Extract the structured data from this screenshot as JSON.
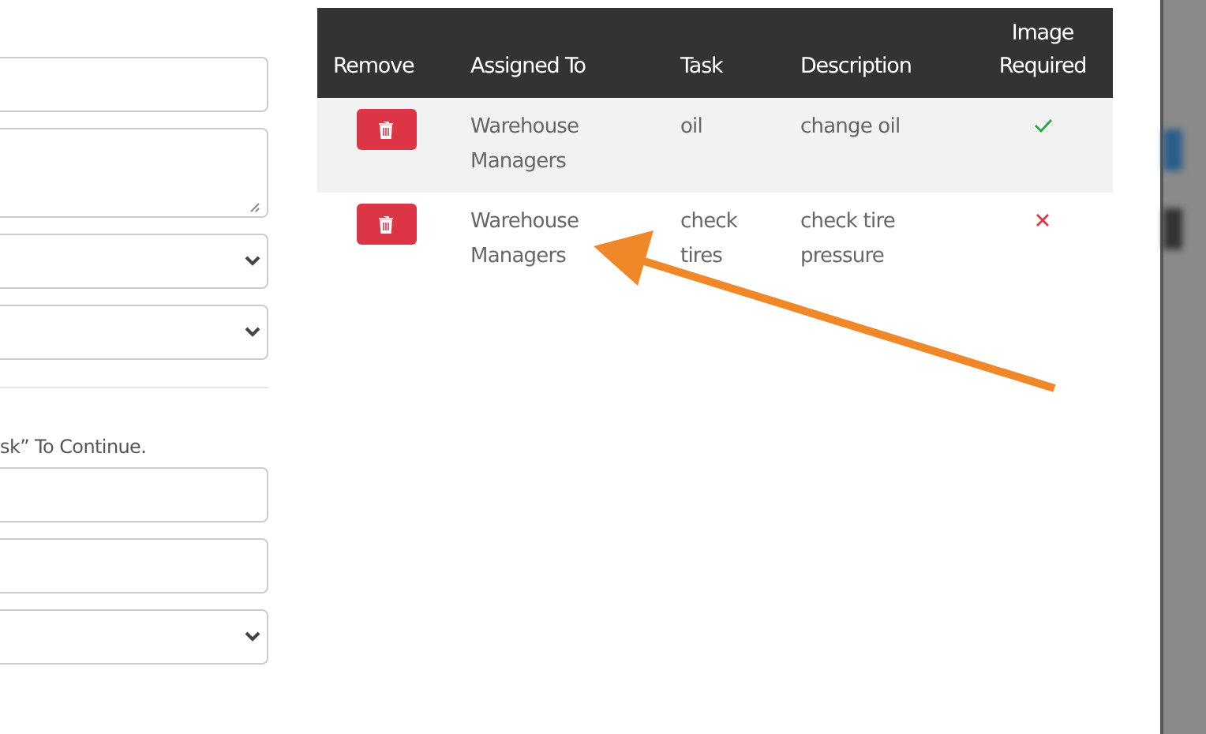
{
  "form": {
    "fields": [
      {
        "kind": "input"
      },
      {
        "kind": "textarea"
      },
      {
        "kind": "select"
      },
      {
        "kind": "select"
      },
      {
        "kind": "divider"
      },
      {
        "kind": "note",
        "text": "sk” To Continue."
      },
      {
        "kind": "input"
      },
      {
        "kind": "input"
      },
      {
        "kind": "select"
      }
    ]
  },
  "table": {
    "columns": [
      "Remove",
      "Assigned To",
      "Task",
      "Description",
      "Image\nRequired"
    ],
    "rows": [
      {
        "assigned_to": "Warehouse Managers",
        "task": "oil",
        "description": "change oil",
        "image_required": true
      },
      {
        "assigned_to": "Warehouse Managers",
        "task": "check tires",
        "description": "check tire pressure",
        "image_required": false
      }
    ]
  },
  "annotation": {
    "kind": "arrow"
  }
}
